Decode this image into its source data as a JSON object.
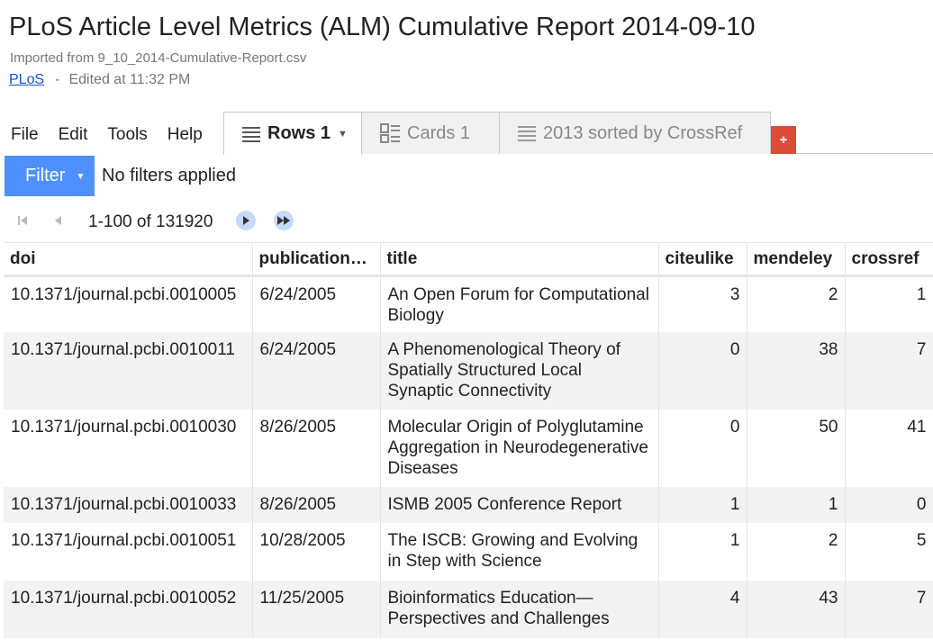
{
  "header": {
    "title": "PLoS Article Level Metrics (ALM) Cumulative Report 2014-09-10",
    "imported_from": "Imported from 9_10_2014-Cumulative-Report.csv",
    "owner": "PLoS",
    "separator": "-",
    "edited": "Edited at 11:32 PM"
  },
  "menu": {
    "file": "File",
    "edit": "Edit",
    "tools": "Tools",
    "help": "Help"
  },
  "tabs": [
    {
      "label": "Rows 1",
      "icon": "rows-icon",
      "active": true
    },
    {
      "label": "Cards 1",
      "icon": "cards-icon",
      "active": false
    },
    {
      "label": "2013 sorted by CrossRef",
      "icon": "rows-icon",
      "active": false
    }
  ],
  "add_tab_label": "+",
  "filter": {
    "button_label": "Filter",
    "status": "No filters applied"
  },
  "pager": {
    "range": "1-100 of 131920"
  },
  "colors": {
    "accent": "#4d90fe",
    "add_tab": "#dd4b39",
    "link": "#1155cc"
  },
  "table": {
    "columns": [
      "doi",
      "publication…",
      "title",
      "citeulike",
      "mendeley",
      "crossref"
    ],
    "rows": [
      {
        "doi": "10.1371/journal.pcbi.0010005",
        "date": "6/24/2005",
        "title": "An Open Forum for Computational Biology",
        "citeulike": "3",
        "mendeley": "2",
        "crossref": "1"
      },
      {
        "doi": "10.1371/journal.pcbi.0010011",
        "date": "6/24/2005",
        "title": "A Phenomenological Theory of Spatially Structured Local Synaptic Connectivity",
        "citeulike": "0",
        "mendeley": "38",
        "crossref": "7"
      },
      {
        "doi": "10.1371/journal.pcbi.0010030",
        "date": "8/26/2005",
        "title": "Molecular Origin of Polyglutamine Aggregation in Neurodegenerative Diseases",
        "citeulike": "0",
        "mendeley": "50",
        "crossref": "41"
      },
      {
        "doi": "10.1371/journal.pcbi.0010033",
        "date": "8/26/2005",
        "title": "ISMB 2005 Conference Report",
        "citeulike": "1",
        "mendeley": "1",
        "crossref": "0"
      },
      {
        "doi": "10.1371/journal.pcbi.0010051",
        "date": "10/28/2005",
        "title": "The ISCB: Growing and Evolving in Step with Science",
        "citeulike": "1",
        "mendeley": "2",
        "crossref": "5"
      },
      {
        "doi": "10.1371/journal.pcbi.0010052",
        "date": "11/25/2005",
        "title": "Bioinformatics Education—Perspectives and Challenges",
        "citeulike": "4",
        "mendeley": "43",
        "crossref": "7"
      }
    ]
  }
}
